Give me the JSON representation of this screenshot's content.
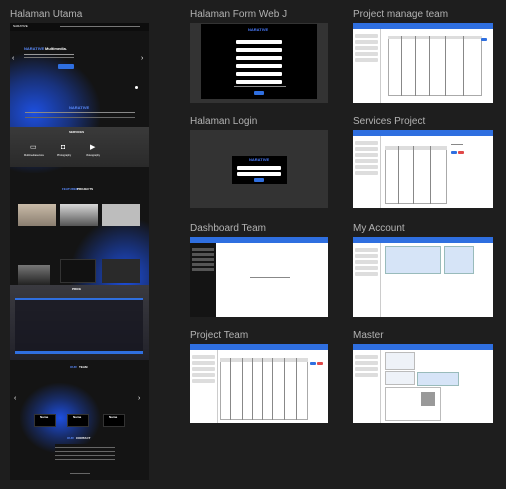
{
  "frames": {
    "home": {
      "label": "Halaman Utama",
      "brand": "NARATIVE",
      "hero_title_accent": "NARATIVE",
      "hero_title": "Multimedia.",
      "about_title": "NARATIVE",
      "services_title": "SERVICES",
      "services": [
        "Multimediaservice",
        "Photography",
        "Videography"
      ],
      "projects_title_a": "FEATURED",
      "projects_title_b": "PROJECTS",
      "price_title": "PRICE",
      "team_title_a": "OUR",
      "team_title_b": "TEAM",
      "team_members": [
        "Nama",
        "Nama",
        "Nama"
      ],
      "contact_title_a": "OUR",
      "contact_title_b": "CONTACT"
    },
    "form": {
      "label": "Halaman Form Web J",
      "title": "NARATIVE"
    },
    "login": {
      "label": "Halaman Login",
      "title": "NARATIVE"
    },
    "project_manage": {
      "label": "Project manage team"
    },
    "services_project": {
      "label": "Services Project"
    },
    "dashboard": {
      "label": "Dashboard Team"
    },
    "account": {
      "label": "My Account"
    },
    "project_team": {
      "label": "Project Team"
    },
    "master": {
      "label": "Master"
    }
  },
  "colors": {
    "canvas": "#1e1e1e",
    "accent": "#2f6fe0",
    "glow": "#1d4fe0"
  }
}
